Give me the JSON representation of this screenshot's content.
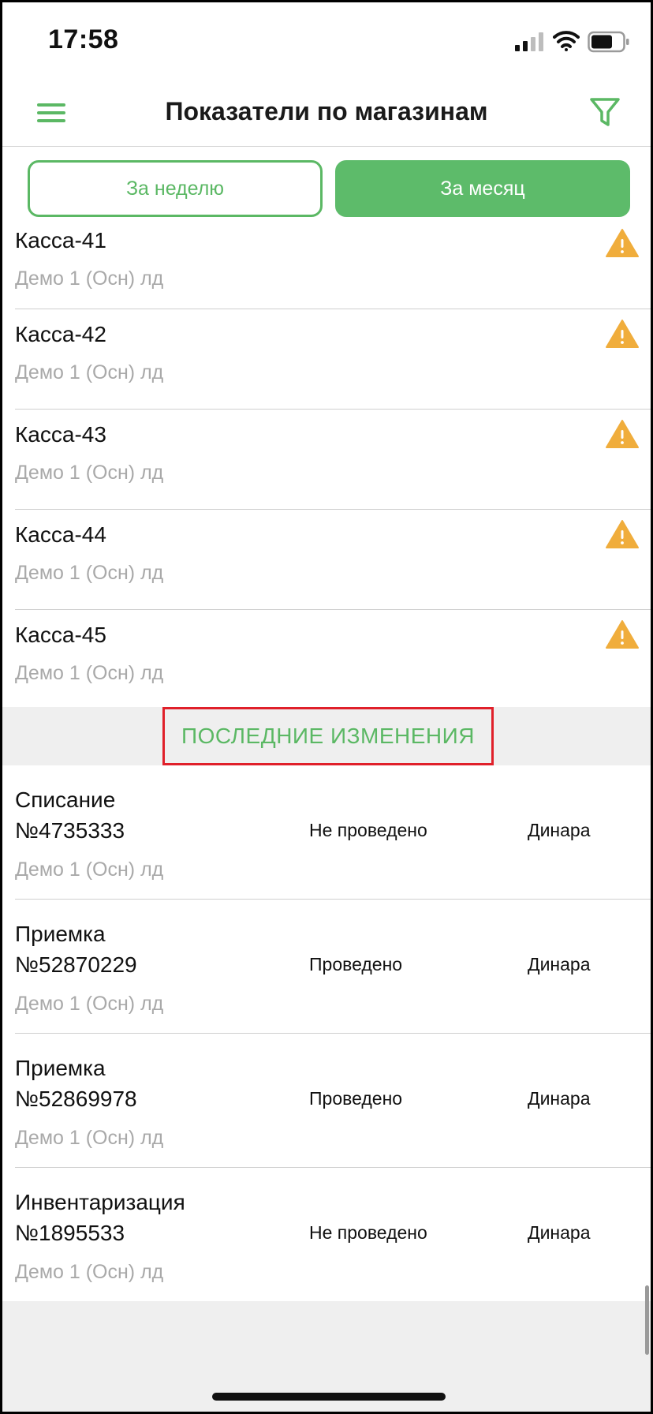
{
  "status_bar": {
    "time": "17:58"
  },
  "header": {
    "title": "Показатели по магазинам"
  },
  "period_tabs": [
    {
      "label": "За неделю",
      "selected": false
    },
    {
      "label": "За месяц",
      "selected": true
    }
  ],
  "kassas": [
    {
      "name": "Касса-41",
      "store": "Демо 1 (Осн) лд",
      "icon": "warning-icon"
    },
    {
      "name": "Касса-42",
      "store": "Демо 1 (Осн) лд",
      "icon": "warning-icon"
    },
    {
      "name": "Касса-43",
      "store": "Демо 1 (Осн) лд",
      "icon": "warning-icon"
    },
    {
      "name": "Касса-44",
      "store": "Демо 1 (Осн) лд",
      "icon": "warning-icon"
    },
    {
      "name": "Касса-45",
      "store": "Демо 1 (Осн) лд",
      "icon": "warning-icon"
    }
  ],
  "recent_changes": {
    "title": "ПОСЛЕДНИЕ ИЗМЕНЕНИЯ",
    "items": [
      {
        "name": "Списание\n№4735333",
        "status": "Не проведено",
        "currency": "Динара",
        "store": "Демо 1 (Осн) лд"
      },
      {
        "name": "Приемка\n№52870229",
        "status": "Проведено",
        "currency": "Динара",
        "store": "Демо 1 (Осн) лд"
      },
      {
        "name": "Приемка\n№52869978",
        "status": "Проведено",
        "currency": "Динара",
        "store": "Демо 1 (Осн) лд"
      },
      {
        "name": "Инвентаризация\n№1895533",
        "status": "Не проведено",
        "currency": "Динара",
        "store": "Демо 1 (Осн) лд"
      }
    ]
  },
  "colors": {
    "accent": "#5dbb6a",
    "warning": "#f0ad3c",
    "highlight": "#e0202a"
  }
}
